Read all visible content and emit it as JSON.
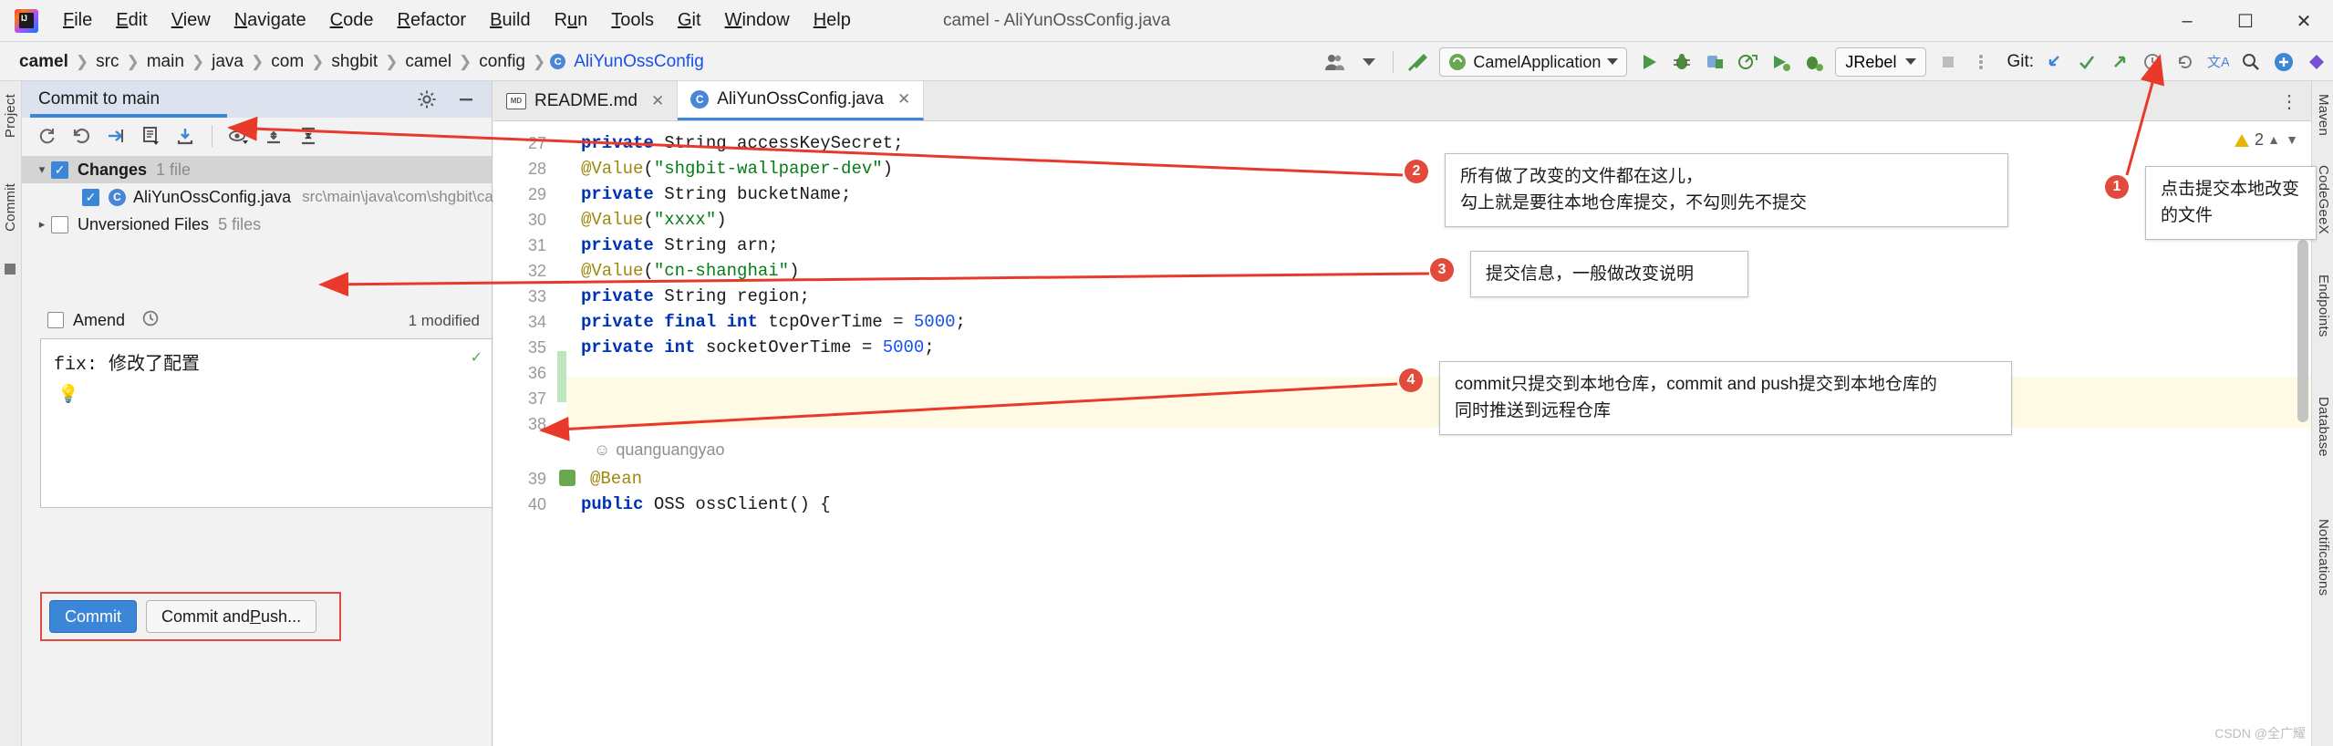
{
  "window": {
    "title": "camel - AliYunOssConfig.java",
    "minimize_icon": "minimize-icon",
    "maximize_icon": "maximize-icon",
    "close_icon": "close-icon"
  },
  "menubar": {
    "items": [
      {
        "label": "File",
        "mnemonic": "F"
      },
      {
        "label": "Edit",
        "mnemonic": "E"
      },
      {
        "label": "View",
        "mnemonic": "V"
      },
      {
        "label": "Navigate",
        "mnemonic": "N"
      },
      {
        "label": "Code",
        "mnemonic": "C"
      },
      {
        "label": "Refactor",
        "mnemonic": "R"
      },
      {
        "label": "Build",
        "mnemonic": "B"
      },
      {
        "label": "Run",
        "mnemonic": "u"
      },
      {
        "label": "Tools",
        "mnemonic": "T"
      },
      {
        "label": "Git",
        "mnemonic": "G"
      },
      {
        "label": "Window",
        "mnemonic": "W"
      },
      {
        "label": "Help",
        "mnemonic": "H"
      }
    ]
  },
  "breadcrumb": {
    "items": [
      "camel",
      "src",
      "main",
      "java",
      "com",
      "shgbit",
      "camel",
      "config",
      "AliYunOssConfig"
    ],
    "separator": "❯",
    "file_icon": "java-class-icon"
  },
  "toolbar": {
    "avatar_icon": "user-group-icon",
    "build_icon": "hammer-icon",
    "run_config": {
      "label": "CamelApplication",
      "icon": "spring-boot-icon",
      "dropdown_icon": "chevron-down-icon"
    },
    "run_icon": "run-play-icon",
    "debug_icon": "debug-bug-icon",
    "run_with_coverage_icon": "run-coverage-icon",
    "profiler_icon": "profiler-icon",
    "jrebel_run_icon": "jrebel-run-icon",
    "jrebel_debug_icon": "jrebel-debug-icon",
    "jrebel": {
      "label": "JRebel",
      "dropdown_icon": "chevron-down-icon"
    },
    "stop_icon": "stop-icon",
    "more_icon": "more-vertical-icon",
    "git_label": "Git:",
    "git_update_icon": "git-update-icon",
    "git_commit_icon": "git-commit-check-icon",
    "git_push_icon": "git-push-arrow-icon",
    "git_history_icon": "git-history-clock-icon",
    "git_rollback_icon": "git-rollback-icon",
    "translate_icon": "translate-icon",
    "search_icon": "search-icon",
    "plugin_icon": "plugin-add-icon",
    "ide_icon": "ide-status-icon"
  },
  "tool_stripes": {
    "left": [
      "Project",
      "Commit"
    ],
    "right": [
      "Maven",
      "CodeGeeX",
      "Endpoints",
      "Database",
      "Notifications"
    ]
  },
  "commit_panel": {
    "tab_title": "Commit to main",
    "gear_icon": "gear-icon",
    "minimize_icon": "minimize-icon",
    "toolbar_icons": [
      "refresh-icon",
      "rollback-icon",
      "shelve-icon",
      "diff-icon",
      "download-icon",
      "preview-eye-icon",
      "expand-all-icon",
      "collapse-all-icon"
    ],
    "tree": [
      {
        "name": "Changes",
        "count": "1 file",
        "checked": true,
        "expanded": true,
        "selected": true,
        "children": [
          {
            "name": "AliYunOssConfig.java",
            "path": "src\\main\\java\\com\\shgbit\\camel\\config",
            "checked": true,
            "icon": "java-class-icon"
          }
        ]
      },
      {
        "name": "Unversioned Files",
        "count": "5 files",
        "checked": false,
        "expanded": false,
        "selected": false,
        "children": []
      }
    ],
    "amend_label": "Amend",
    "amend_checked": false,
    "history_icon": "clock-icon",
    "modified_label": "1 modified",
    "message_value": "fix: 修改了配置",
    "message_check_icon": "check-icon",
    "bulb_icon": "lightbulb-icon",
    "commit_button": "Commit",
    "commit_push_button": "Commit and Push...",
    "commit_push_mnemonic": "P",
    "bottom_gear_icon": "gear-icon"
  },
  "editor": {
    "tabs": [
      {
        "label": "README.md",
        "icon": "markdown-icon",
        "active": false,
        "close_icon": "close-icon"
      },
      {
        "label": "AliYunOssConfig.java",
        "icon": "java-class-icon",
        "active": true,
        "close_icon": "close-icon"
      }
    ],
    "more_icon": "more-vertical-icon",
    "warning_count": "2",
    "warning_icon": "warning-triangle-icon",
    "up_icon": "chevron-up-icon",
    "down_icon": "chevron-down-icon",
    "author_hint": "quanguangyao",
    "lines": [
      {
        "num": "27",
        "tokens": [
          {
            "t": "private",
            "c": "kw"
          },
          {
            "t": " String accessKeySecret;",
            "c": "nm"
          }
        ]
      },
      {
        "num": "28",
        "tokens": [
          {
            "t": "@Value",
            "c": "an"
          },
          {
            "t": "(",
            "c": "nm"
          },
          {
            "t": "\"shgbit-wallpaper-dev\"",
            "c": "st"
          },
          {
            "t": ")",
            "c": "nm"
          }
        ]
      },
      {
        "num": "29",
        "tokens": [
          {
            "t": "private",
            "c": "kw"
          },
          {
            "t": " String bucketName;",
            "c": "nm"
          }
        ]
      },
      {
        "num": "30",
        "tokens": [
          {
            "t": "@Value",
            "c": "an"
          },
          {
            "t": "(",
            "c": "nm"
          },
          {
            "t": "\"xxxx\"",
            "c": "st"
          },
          {
            "t": ")",
            "c": "nm"
          }
        ]
      },
      {
        "num": "31",
        "tokens": [
          {
            "t": "private",
            "c": "kw"
          },
          {
            "t": " String arn;",
            "c": "nm"
          }
        ]
      },
      {
        "num": "32",
        "tokens": [
          {
            "t": "@Value",
            "c": "an"
          },
          {
            "t": "(",
            "c": "nm"
          },
          {
            "t": "\"cn-shanghai\"",
            "c": "st"
          },
          {
            "t": ")",
            "c": "nm"
          }
        ]
      },
      {
        "num": "33",
        "tokens": [
          {
            "t": "private",
            "c": "kw"
          },
          {
            "t": " String region;",
            "c": "nm"
          }
        ]
      },
      {
        "num": "34",
        "tokens": [
          {
            "t": "private",
            "c": "kw"
          },
          {
            "t": " ",
            "c": "nm"
          },
          {
            "t": "final",
            "c": "kw"
          },
          {
            "t": " ",
            "c": "nm"
          },
          {
            "t": "int",
            "c": "kw"
          },
          {
            "t": " tcpOverTime = ",
            "c": "nm"
          },
          {
            "t": "5000",
            "c": "num"
          },
          {
            "t": ";",
            "c": "nm"
          }
        ]
      },
      {
        "num": "35",
        "tokens": [
          {
            "t": "private",
            "c": "kw"
          },
          {
            "t": " ",
            "c": "nm"
          },
          {
            "t": "int",
            "c": "kw"
          },
          {
            "t": " socketOverTime = ",
            "c": "nm"
          },
          {
            "t": "5000",
            "c": "num"
          },
          {
            "t": ";",
            "c": "nm"
          }
        ]
      },
      {
        "num": "36",
        "tokens": []
      },
      {
        "num": "37",
        "tokens": []
      },
      {
        "num": "38",
        "tokens": []
      },
      {
        "num": "39",
        "tokens": [
          {
            "t": "@Bean",
            "c": "an"
          }
        ]
      },
      {
        "num": "40",
        "tokens": [
          {
            "t": "public",
            "c": "kw"
          },
          {
            "t": " OSS ossClient() {",
            "c": "nm"
          }
        ]
      }
    ]
  },
  "annotations": [
    {
      "badge": "1",
      "text": "点击提交本地改变的文件"
    },
    {
      "badge": "2",
      "text": "所有做了改变的文件都在这儿，\n勾上就是要往本地仓库提交，不勾则先不提交"
    },
    {
      "badge": "3",
      "text": "提交信息，一般做改变说明"
    },
    {
      "badge": "4",
      "text": "commit只提交到本地仓库，commit and push提交到本地仓库的\n同时推送到远程仓库"
    }
  ],
  "watermark": "CSDN @全广耀",
  "colors": {
    "accent_blue": "#3c86d8",
    "annotation_red": "#e24a3b",
    "keyword_blue": "#0033b3",
    "string_green": "#067d17",
    "annotation_gold": "#9e880d"
  }
}
